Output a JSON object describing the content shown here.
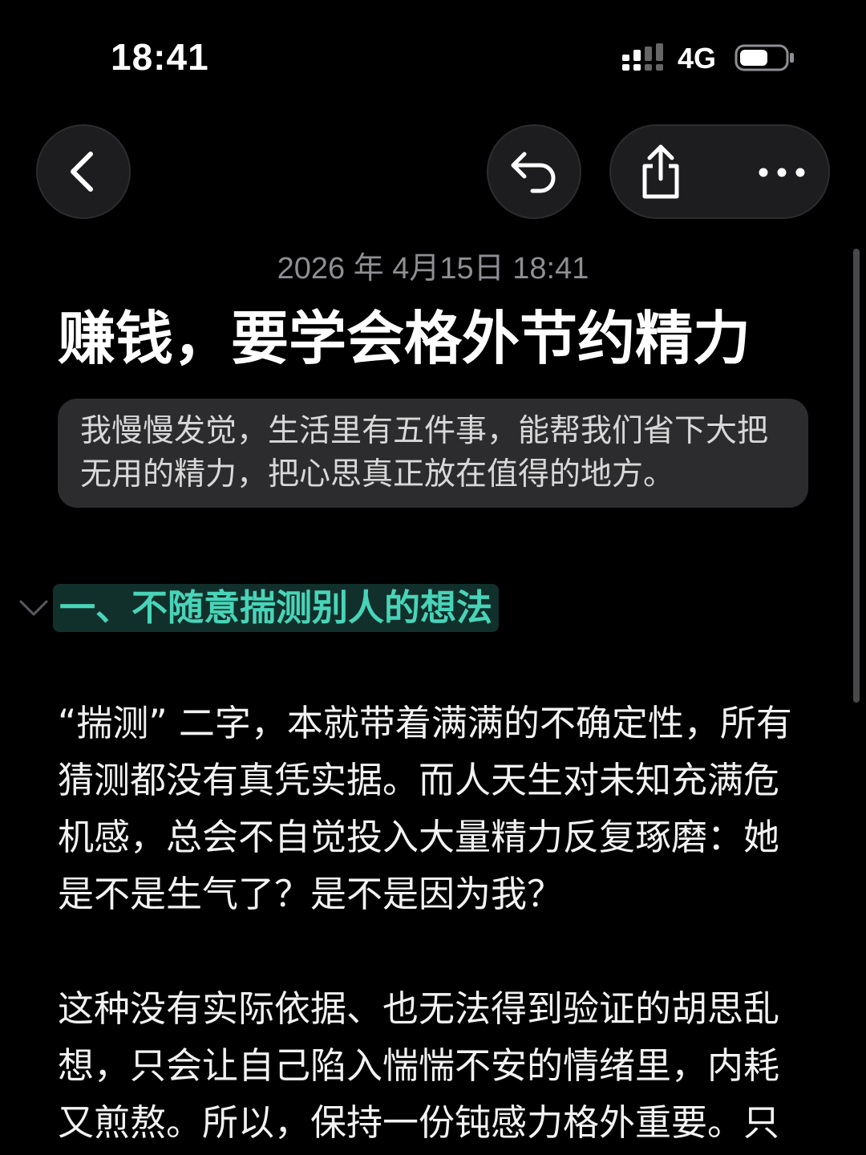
{
  "status_bar": {
    "time": "18:41",
    "network": "4G",
    "signal_icon": "signal-bars-icon",
    "battery_icon": "battery-icon"
  },
  "toolbar": {
    "back_icon": "chevron-left-icon",
    "undo_icon": "undo-arrow-icon",
    "share_icon": "share-icon",
    "more_icon": "ellipsis-icon"
  },
  "note": {
    "date": "2026 年 4月15日 18:41",
    "title": "赚钱，要学会格外节约精力",
    "quote": "我慢慢发觉，生活里有五件事，能帮我们省下大把无用的精力，把心思真正放在值得的地方。",
    "section_heading": "一、不随意揣测别人的想法",
    "paragraphs": [
      "“揣测” 二字，本就带着满满的不确定性，所有猜测都没有真凭实据。而人天生对未知充满危机感，总会不自觉投入大量精力反复琢磨：她是不是生气了？是不是因为我？",
      "这种没有实际依据、也无法得到验证的胡思乱想，只会让自己陷入惴惴不安的情绪里，内耗又煎熬。所以，保持一份钝感力格外重要。只"
    ]
  },
  "colors": {
    "background": "#000000",
    "heading_text": "#48d4b8",
    "heading_highlight": "#12302b",
    "quote_background": "#2c2c2e",
    "date_text": "#8e8e93"
  }
}
